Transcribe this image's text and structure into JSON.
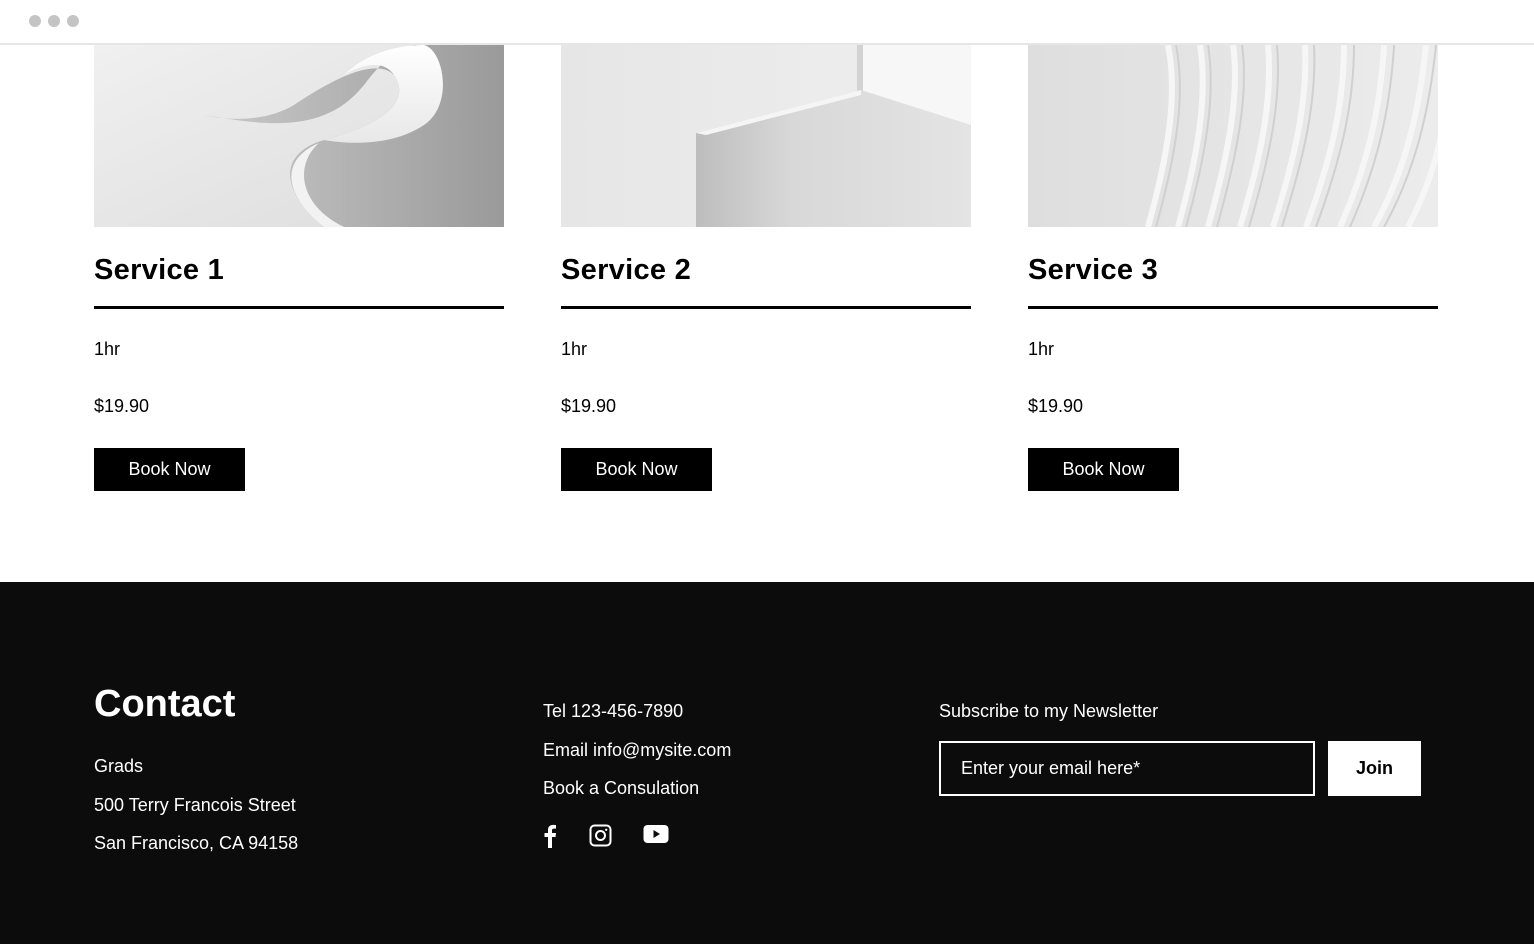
{
  "window": {
    "controls": [
      "dot-1",
      "dot-2",
      "dot-3"
    ]
  },
  "services": [
    {
      "title": "Service 1",
      "duration": "1hr",
      "price": "$19.90",
      "button": "Book Now"
    },
    {
      "title": "Service 2",
      "duration": "1hr",
      "price": "$19.90",
      "button": "Book Now"
    },
    {
      "title": "Service 3",
      "duration": "1hr",
      "price": "$19.90",
      "button": "Book Now"
    }
  ],
  "footer": {
    "contact_title": "Contact",
    "address": {
      "line1": "Grads",
      "line2": "500 Terry Francois Street",
      "line3": "San Francisco, CA 94158"
    },
    "tel": "Tel 123-456-7890",
    "email": "Email info@mysite.com",
    "book": "Book a Consulation",
    "social_icons": [
      "facebook-icon",
      "instagram-icon",
      "youtube-icon"
    ],
    "newsletter": {
      "title": "Subscribe to my Newsletter",
      "placeholder": "Enter your email here*",
      "join": "Join"
    }
  },
  "colors": {
    "footer_bg": "#0c0c0c",
    "button_bg": "#000000",
    "button_text": "#ffffff",
    "accent_light": "#ffffff"
  }
}
